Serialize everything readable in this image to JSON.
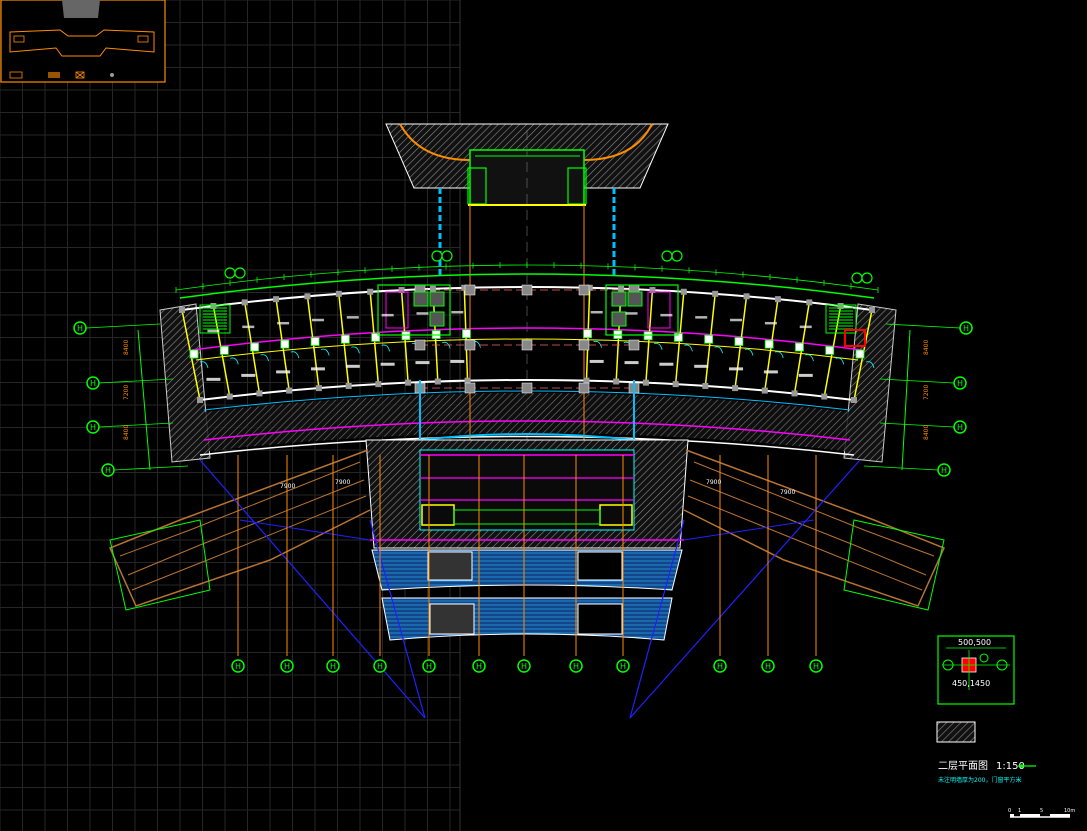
{
  "drawing": {
    "title": "二层平面图",
    "scale": "1:150",
    "note": "未注明墙厚为200，门窗平方米",
    "column_detail": {
      "top_dim": "500,500",
      "bottom_dim": "450,1450"
    },
    "scale_bar": {
      "ticks": [
        "0",
        "1",
        "5",
        "10m"
      ]
    },
    "bay_dims": [
      "7900",
      "7900",
      "7900",
      "7900"
    ],
    "side_dims_left": [
      "8400",
      "7200",
      "8400"
    ],
    "side_dims_right": [
      "8400",
      "7200",
      "8400"
    ],
    "bubble_axes_bottom": [
      "H",
      "H",
      "H",
      "H",
      "H",
      "H",
      "H",
      "H",
      "H",
      "H",
      "H",
      "H"
    ],
    "bubble_axes_left": [
      "H",
      "H",
      "H",
      "H"
    ],
    "bubble_axes_right": [
      "H",
      "H",
      "H",
      "H"
    ],
    "colors": {
      "background": "#000000",
      "grid": "#2a2a2a",
      "wall": "#ffffff",
      "dimension": "#00ff00",
      "axis": "#ff8c00",
      "column": "#ffff00",
      "hatch": "#9a9a9a",
      "glazing": "#1e90ff",
      "magenta": "#ff00ff",
      "cyan": "#00ffff",
      "blue": "#0000ff",
      "red": "#ff0000",
      "brown": "#8b5a2b"
    }
  }
}
